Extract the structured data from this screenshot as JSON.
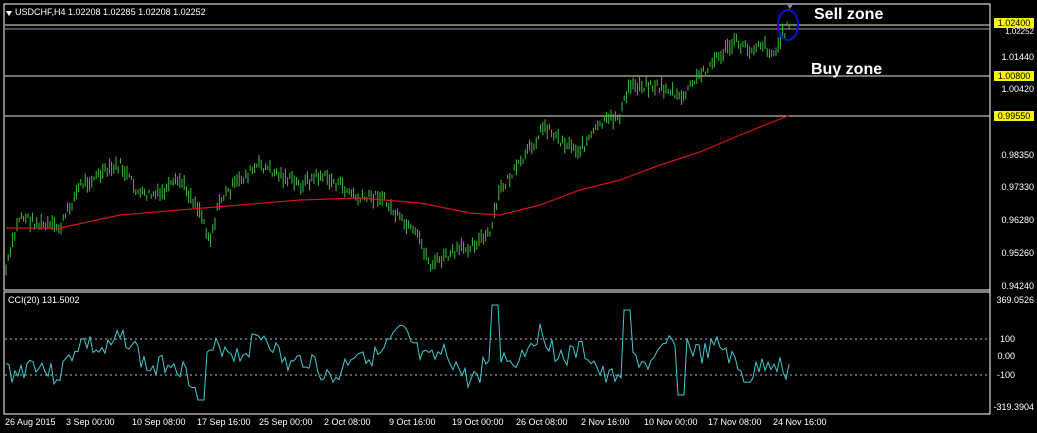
{
  "symbol_info": "USDCHF,H4  1.02208 1.02285 1.02208 1.02252",
  "cci_info": "CCI(20) 131.5002",
  "annotations": {
    "sell_zone": "Sell zone",
    "buy_zone": "Buy zone"
  },
  "levels": [
    {
      "label": "1.02400",
      "value": 1.024
    },
    {
      "label": "1.00800",
      "value": 1.008
    },
    {
      "label": "0.99550",
      "value": 0.9955
    }
  ],
  "current_price_label": "1.02252",
  "price_axis": [
    "1.01440",
    "1.00420",
    "0.98350",
    "0.97330",
    "0.96280",
    "0.95260",
    "0.94240"
  ],
  "cci_axis": [
    "369.0526",
    "100",
    "0.00",
    "-100",
    "-319.3904"
  ],
  "time_axis": [
    "26 Aug 2015",
    "3 Sep 00:00",
    "10 Sep 08:00",
    "17 Sep 16:00",
    "25 Sep 00:00",
    "2 Oct 08:00",
    "9 Oct 16:00",
    "19 Oct 00:00",
    "26 Oct 08:00",
    "2 Nov 16:00",
    "10 Nov 00:00",
    "17 Nov 08:00",
    "24 Nov 16:00"
  ],
  "colors": {
    "bars": "#3cbd3c",
    "ma": "#d41414",
    "cci": "#40c8d0",
    "level_line": "#e8e8c8",
    "level_tag": "#f6f600",
    "marker": "#1010d0"
  },
  "icons": {
    "menu": "triangle-down-icon",
    "marker": "ellipse-marker-icon"
  }
}
